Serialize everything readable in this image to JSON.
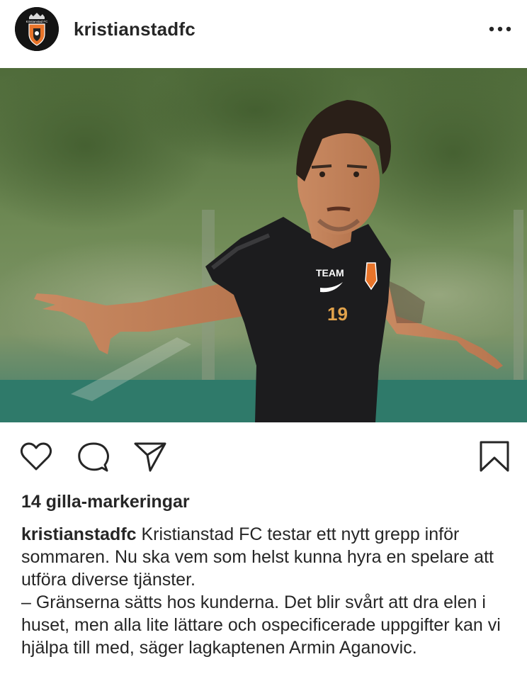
{
  "post": {
    "username": "kristianstadfc",
    "avatar_icon": "kristianstad-fc-crest-icon",
    "more_icon": "more-options-icon",
    "photo_icon": "soccer-player-photo",
    "jersey_number": "19",
    "avatar_text": "Kristianstad FC"
  },
  "actions": {
    "like_icon": "heart-icon",
    "comment_icon": "comment-icon",
    "share_icon": "send-icon",
    "save_icon": "bookmark-icon"
  },
  "likes": {
    "text": "14 gilla-markeringar"
  },
  "caption": {
    "username": "kristianstadfc",
    "text": " Kristianstad FC testar ett nytt grepp inför sommaren. Nu ska vem som helst kunna hyra en spelare att utföra diverse tjänster.",
    "quote": "– Gränserna sätts hos kunderna. Det blir svårt att dra elen i huset, men alla lite lättare och ospecificerade uppgifter kan vi hjälpa till med, säger lagkaptenen Armin Aganovic."
  },
  "colors": {
    "text": "#262626",
    "background": "#ffffff",
    "crest_orange": "#e8742a",
    "jersey": "#1c1c1e",
    "grass": "#2f7a6a"
  }
}
